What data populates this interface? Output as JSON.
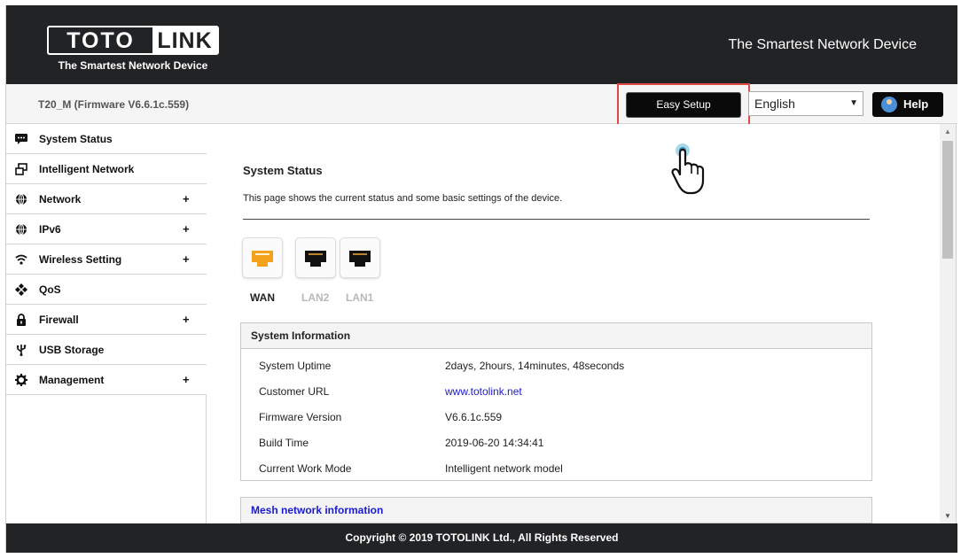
{
  "header": {
    "logo_word1": "TOTO",
    "logo_word2": "LINK",
    "logo_tagline": "The Smartest Network Device",
    "slogan": "The Smartest Network Device"
  },
  "toolbar": {
    "model": "T20_M (Firmware V6.6.1c.559)",
    "easy_setup": "Easy Setup",
    "language": "English",
    "help": "Help",
    "highlight_color": "#e04a44"
  },
  "sidebar": {
    "items": [
      {
        "label": "System Status",
        "icon": "chat-icon",
        "expandable": false
      },
      {
        "label": "Intelligent Network",
        "icon": "windows-icon",
        "expandable": false
      },
      {
        "label": "Network",
        "icon": "globe-icon",
        "expandable": true
      },
      {
        "label": "IPv6",
        "icon": "globe-icon",
        "expandable": true
      },
      {
        "label": "Wireless Setting",
        "icon": "wifi-icon",
        "expandable": true
      },
      {
        "label": "QoS",
        "icon": "qos-icon",
        "expandable": false
      },
      {
        "label": "Firewall",
        "icon": "lock-icon",
        "expandable": true
      },
      {
        "label": "USB Storage",
        "icon": "usb-icon",
        "expandable": false
      },
      {
        "label": "Management",
        "icon": "gear-icon",
        "expandable": true
      }
    ],
    "plus": "+"
  },
  "main": {
    "title": "System Status",
    "description": "This page shows the current status and some basic settings of the device.",
    "ports": [
      {
        "label": "WAN",
        "active": true,
        "color": "#f2a21b"
      },
      {
        "label": "LAN2",
        "active": false,
        "color": "#111111"
      },
      {
        "label": "LAN1",
        "active": false,
        "color": "#111111"
      }
    ],
    "system_info": {
      "title": "System Information",
      "rows": [
        {
          "key": "System Uptime",
          "value": "2days, 2hours, 14minutes, 48seconds"
        },
        {
          "key": "Customer URL",
          "value": "www.totolink.net"
        },
        {
          "key": "Firmware Version",
          "value": "V6.6.1c.559"
        },
        {
          "key": "Build Time",
          "value": "2019-06-20 14:34:41"
        },
        {
          "key": "Current Work Mode",
          "value": "Intelligent network model"
        }
      ]
    },
    "mesh": {
      "title": "Mesh network information",
      "title_color": "#1a1ad0"
    }
  },
  "footer": {
    "copyright": "Copyright © 2019 TOTOLINK Ltd., All Rights Reserved"
  }
}
